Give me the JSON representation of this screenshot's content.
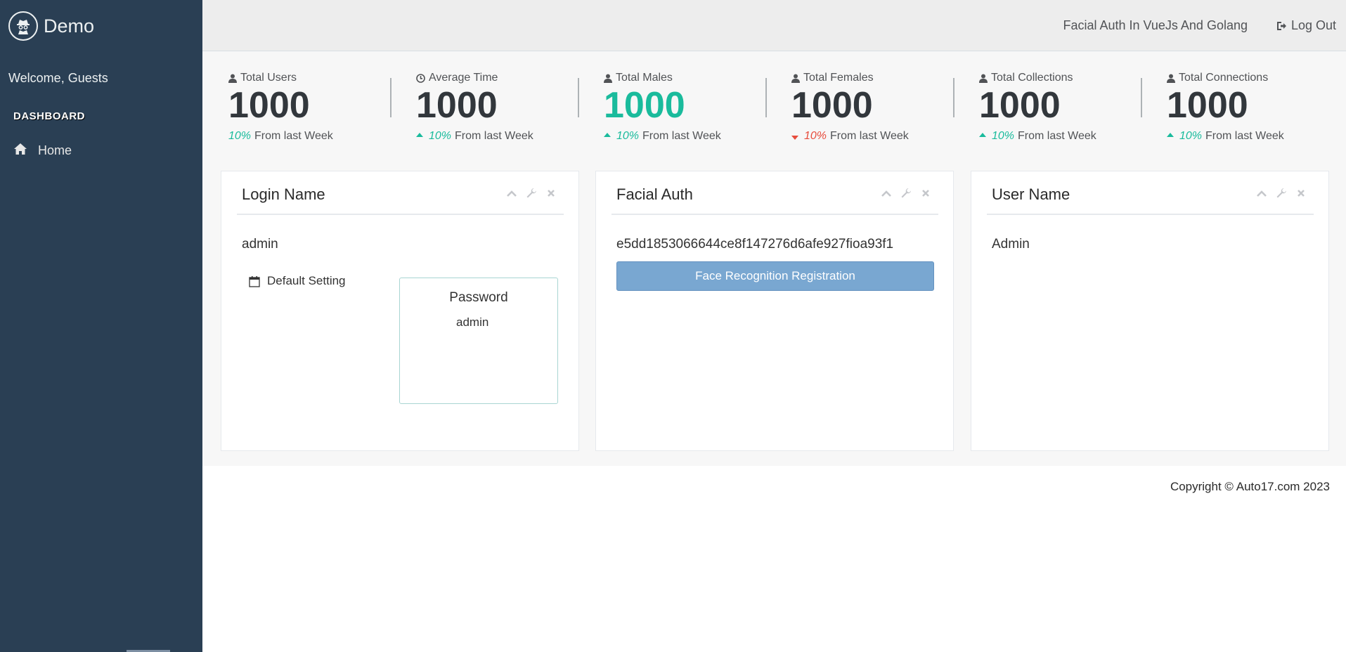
{
  "sidebar": {
    "brand_title": "Demo",
    "welcome": "Welcome, Guests",
    "section_title": "DASHBOARD",
    "items": [
      {
        "label": "Home",
        "icon": "home-icon"
      }
    ]
  },
  "topnav": {
    "app_link": "Facial Auth In VueJs And Golang",
    "logout_label": "Log Out"
  },
  "tiles": [
    {
      "caption": "Total Users",
      "icon": "user-icon",
      "count": "1000",
      "pct": "10%",
      "trend": "none",
      "foot": "From last Week",
      "count_color": "dark"
    },
    {
      "caption": "Average Time",
      "icon": "clock-icon",
      "count": "1000",
      "pct": "10%",
      "trend": "up",
      "foot": "From last Week",
      "count_color": "dark"
    },
    {
      "caption": "Total Males",
      "icon": "user-icon",
      "count": "1000",
      "pct": "10%",
      "trend": "up",
      "foot": "From last Week",
      "count_color": "green"
    },
    {
      "caption": "Total Females",
      "icon": "user-icon",
      "count": "1000",
      "pct": "10%",
      "trend": "down",
      "foot": "From last Week",
      "count_color": "dark"
    },
    {
      "caption": "Total Collections",
      "icon": "user-icon",
      "count": "1000",
      "pct": "10%",
      "trend": "up",
      "foot": "From last Week",
      "count_color": "dark"
    },
    {
      "caption": "Total Connections",
      "icon": "user-icon",
      "count": "1000",
      "pct": "10%",
      "trend": "up",
      "foot": "From last Week",
      "count_color": "dark"
    }
  ],
  "panels": {
    "login": {
      "title": "Login Name",
      "value": "admin",
      "default_setting": "Default Setting",
      "password_title": "Password",
      "password_value": "admin"
    },
    "facial": {
      "title": "Facial Auth",
      "value": "e5dd1853066644ce8f147276d6afe927fioa93f1",
      "button_label": "Face Recognition Registration"
    },
    "user": {
      "title": "User Name",
      "value": "Admin"
    }
  },
  "footer": {
    "copyright": "Copyright © Auto17.com 2023"
  },
  "colors": {
    "sidebar_bg": "#2A3F54",
    "accent_green": "#1ABB9C",
    "accent_red": "#E74C3C",
    "button_blue": "#79A7D1"
  }
}
